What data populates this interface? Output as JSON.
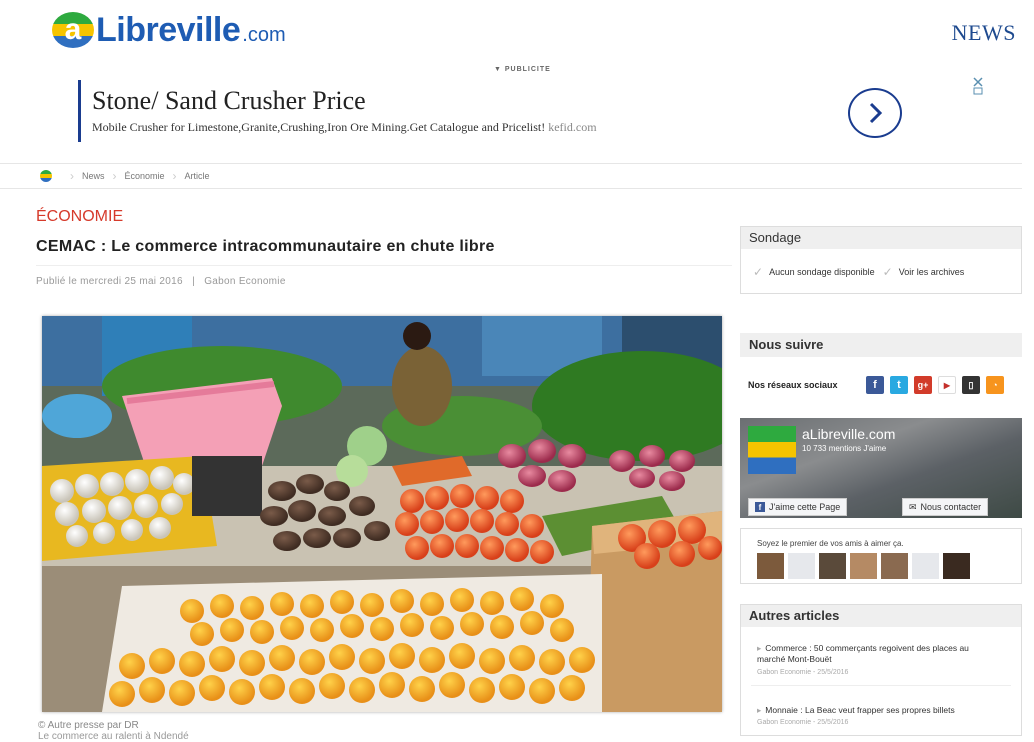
{
  "header": {
    "logo_a": "a",
    "logo_name": "Libreville",
    "logo_tld": ".com",
    "section": "NEWS"
  },
  "ad": {
    "label": "▼ PUBLICITE",
    "title": "Stone/ Sand Crusher Price",
    "description": "Mobile Crusher for Limestone,Granite,Crushing,Iron Ore Mining.Get Catalogue and Pricelist!",
    "domain": "kefid.com"
  },
  "breadcrumb": [
    "News",
    "Économie",
    "Article"
  ],
  "article": {
    "rubrique": "ÉCONOMIE",
    "title": "CEMAC : Le commerce intracommunautaire en chute libre",
    "meta": "Publié le mercredi 25 mai 2016   |   Gabon Economie",
    "photo_credit": "© Autre presse par DR",
    "photo_caption": "Le commerce au ralenti à Ndendé"
  },
  "sidebar": {
    "sondage": {
      "title": "Sondage",
      "none": "Aucun sondage disponible",
      "archives": "Voir les archives"
    },
    "suivre": {
      "title": "Nous suivre",
      "reseaux": "Nos réseaux sociaux",
      "icons": [
        "facebook-icon",
        "twitter-icon",
        "google-plus-icon",
        "youtube-icon",
        "mobile-icon",
        "rss-icon"
      ]
    },
    "facebook": {
      "page_name": "aLibreville.com",
      "likes": "10 733 mentions J'aime",
      "like_button": "J'aime cette Page",
      "contact_button": "Nous contacter",
      "friends_text": "Soyez le premier de vos amis à aimer ça."
    },
    "autres": {
      "title": "Autres articles",
      "items": [
        {
          "title": "Commerce : 50 commerçants regoivent des places au marché Mont-Bouët",
          "source": "Gabon Economie - 25/5/2016"
        },
        {
          "title": "Monnaie : La Beac veut frapper ses propres billets",
          "source": "Gabon Economie - 25/5/2016"
        }
      ]
    }
  },
  "colors": {
    "brand_blue": "#1e5cb3",
    "rubrique_red": "#d63a2b",
    "gabon_green": "#2eaa3f",
    "gabon_yellow": "#f5c400",
    "gabon_blue": "#2f6fc0"
  }
}
